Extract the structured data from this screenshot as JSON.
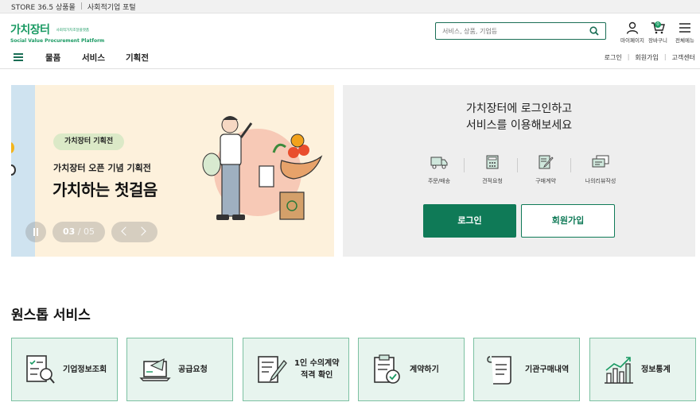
{
  "topbar": {
    "link1": "STORE 36.5 상품몰",
    "sep": "|",
    "link2": "사회적기업 포털"
  },
  "header": {
    "logo_main": "가치장터",
    "logo_sub": "사회적가치조달플랫폼",
    "logo_en": "Social Value Procurement Platform",
    "search_placeholder": "서비스, 상품, 기업등",
    "mypage_label": "마이페이지",
    "cart_label": "장바구니",
    "cart_count": "0",
    "menu_label": "전체메뉴"
  },
  "nav": {
    "items": [
      "물품",
      "서비스",
      "기획전"
    ],
    "right": [
      "로그인",
      "회원가입",
      "고객센터"
    ]
  },
  "banner": {
    "pill": "가치장터 기획전",
    "subtitle": "가치장터 오픈 기념 기획전",
    "title": "가치하는 첫걸음",
    "current": "03",
    "slash": "/",
    "total": "05"
  },
  "login_panel": {
    "line1": "가치장터에 로그인하고",
    "line2": "서비스를 이용해보세요",
    "services": [
      "주문/배송",
      "견적요청",
      "구매계약",
      "나의리뷰작성"
    ],
    "login_button": "로그인",
    "join_button": "회원가입"
  },
  "onestop": {
    "title": "원스톱 서비스",
    "cards": [
      {
        "label": "기업정보조회"
      },
      {
        "label": "공급요청"
      },
      {
        "label1": "1인 수의계약",
        "label2": "적격 확인"
      },
      {
        "label": "계약하기"
      },
      {
        "label": "기관구매내역"
      },
      {
        "label": "정보통계"
      }
    ]
  },
  "colors": {
    "brand": "#1a9a63",
    "primary_button": "#0f7a57",
    "card_bg": "#e7f4ee",
    "banner_bg": "#fdf1dc"
  }
}
